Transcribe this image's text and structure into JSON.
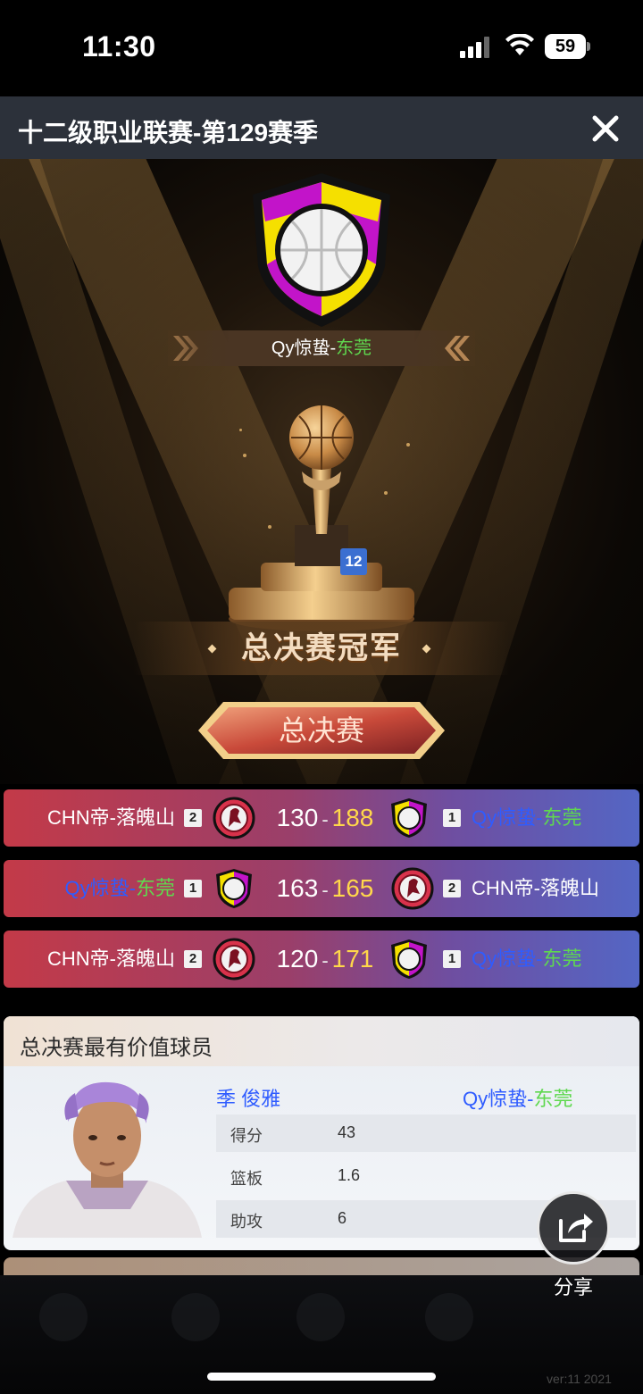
{
  "status_bar": {
    "time": "11:30",
    "battery": "59"
  },
  "header": {
    "title": "十二级职业联赛-第129赛季"
  },
  "champion": {
    "team_prefix": "Qy惊蛰-",
    "team_city": "东莞",
    "trophy_badge": "12",
    "title": "总决赛冠军"
  },
  "finals_tab": {
    "label": "总决赛"
  },
  "matches": [
    {
      "left_team": "CHN帝-落魄山",
      "left_seed": "2",
      "left_score": "130",
      "sep": "-",
      "right_score": "188",
      "right_seed": "1",
      "right_team_prefix": "Qy惊蛰-",
      "right_team_city": "东莞"
    },
    {
      "left_team_prefix": "Qy惊蛰-",
      "left_team_city": "东莞",
      "left_seed": "1",
      "left_score": "163",
      "sep": "-",
      "right_score": "165",
      "right_seed": "2",
      "right_team": "CHN帝-落魄山"
    },
    {
      "left_team": "CHN帝-落魄山",
      "left_seed": "2",
      "left_score": "120",
      "sep": "-",
      "right_score": "171",
      "right_seed": "1",
      "right_team_prefix": "Qy惊蛰-",
      "right_team_city": "东莞"
    }
  ],
  "mvp": {
    "title": "总决赛最有价值球员",
    "player_name": "季 俊雅",
    "team_prefix": "Qy惊蛰-",
    "team_city": "东莞",
    "stats": [
      {
        "label": "得分",
        "value": "43"
      },
      {
        "label": "篮板",
        "value": "1.6"
      },
      {
        "label": "助攻",
        "value": "6"
      }
    ]
  },
  "share": {
    "label": "分享"
  },
  "footer": {
    "version": "ver:11  2021"
  },
  "colors": {
    "team_blue": "#2f5cff",
    "team_green": "#5fd84f",
    "winner_score": "#ffd74a"
  },
  "icons": [
    "signal-icon",
    "wifi-icon",
    "battery-icon",
    "close-icon",
    "team-shield-icon",
    "trophy-icon",
    "share-icon"
  ]
}
